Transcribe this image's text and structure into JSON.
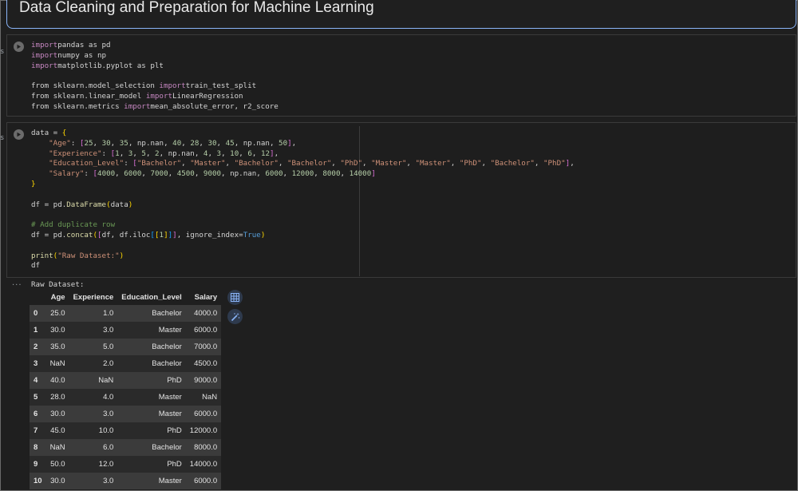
{
  "title": "Data Cleaning and Preparation for Machine Learning",
  "cell1": {
    "marker": "s",
    "lines": [
      [
        [
          "kw",
          "import"
        ],
        [
          "",
          "pandas as pd"
        ]
      ],
      [
        [
          "kw",
          "import"
        ],
        [
          "",
          "numpy as np"
        ]
      ],
      [
        [
          "kw",
          "import"
        ],
        [
          "",
          "matplotlib.pyplot as plt"
        ]
      ],
      [],
      [
        [
          "",
          "from sklearn.model_selection "
        ],
        [
          "kw",
          "import"
        ],
        [
          "",
          "train_test_split"
        ]
      ],
      [
        [
          "",
          "from sklearn.linear_model "
        ],
        [
          "kw",
          "import"
        ],
        [
          "",
          "LinearRegression"
        ]
      ],
      [
        [
          "",
          "from sklearn.metrics "
        ],
        [
          "kw",
          "import"
        ],
        [
          "",
          "mean_absolute_error, r2_score"
        ]
      ]
    ]
  },
  "cell2": {
    "marker": "s",
    "lines": [
      [
        [
          "",
          "data = "
        ],
        [
          "p1",
          "{"
        ]
      ],
      [
        [
          "",
          "    "
        ],
        [
          "str",
          "\"Age\""
        ],
        [
          "",
          ": "
        ],
        [
          "p2",
          "["
        ],
        [
          "num",
          "25"
        ],
        [
          "",
          ", "
        ],
        [
          "num",
          "30"
        ],
        [
          "",
          ", "
        ],
        [
          "num",
          "35"
        ],
        [
          "",
          ", np.nan, "
        ],
        [
          "num",
          "40"
        ],
        [
          "",
          ", "
        ],
        [
          "num",
          "28"
        ],
        [
          "",
          ", "
        ],
        [
          "num",
          "30"
        ],
        [
          "",
          ", "
        ],
        [
          "num",
          "45"
        ],
        [
          "",
          ", np.nan, "
        ],
        [
          "num",
          "50"
        ],
        [
          "p2",
          "]"
        ],
        [
          "",
          ","
        ]
      ],
      [
        [
          "",
          "    "
        ],
        [
          "str",
          "\"Experience\""
        ],
        [
          "",
          ": "
        ],
        [
          "p2",
          "["
        ],
        [
          "num",
          "1"
        ],
        [
          "",
          ", "
        ],
        [
          "num",
          "3"
        ],
        [
          "",
          ", "
        ],
        [
          "num",
          "5"
        ],
        [
          "",
          ", "
        ],
        [
          "num",
          "2"
        ],
        [
          "",
          ", np.nan, "
        ],
        [
          "num",
          "4"
        ],
        [
          "",
          ", "
        ],
        [
          "num",
          "3"
        ],
        [
          "",
          ", "
        ],
        [
          "num",
          "10"
        ],
        [
          "",
          ", "
        ],
        [
          "num",
          "6"
        ],
        [
          "",
          ", "
        ],
        [
          "num",
          "12"
        ],
        [
          "p2",
          "]"
        ],
        [
          "",
          ","
        ]
      ],
      [
        [
          "",
          "    "
        ],
        [
          "str",
          "\"Education_Level\""
        ],
        [
          "",
          ": "
        ],
        [
          "p2",
          "["
        ],
        [
          "str",
          "\"Bachelor\""
        ],
        [
          "",
          ", "
        ],
        [
          "str",
          "\"Master\""
        ],
        [
          "",
          ", "
        ],
        [
          "str",
          "\"Bachelor\""
        ],
        [
          "",
          ", "
        ],
        [
          "str",
          "\"Bachelor\""
        ],
        [
          "",
          ", "
        ],
        [
          "str",
          "\"PhD\""
        ],
        [
          "",
          ", "
        ],
        [
          "str",
          "\"Master\""
        ],
        [
          "",
          ", "
        ],
        [
          "str",
          "\"Master\""
        ],
        [
          "",
          ", "
        ],
        [
          "str",
          "\"PhD\""
        ],
        [
          "",
          ", "
        ],
        [
          "str",
          "\"Bachelor\""
        ],
        [
          "",
          ", "
        ],
        [
          "str",
          "\"PhD\""
        ],
        [
          "p2",
          "]"
        ],
        [
          "",
          ","
        ]
      ],
      [
        [
          "",
          "    "
        ],
        [
          "str",
          "\"Salary\""
        ],
        [
          "",
          ": "
        ],
        [
          "p2",
          "["
        ],
        [
          "num",
          "4000"
        ],
        [
          "",
          ", "
        ],
        [
          "num",
          "6000"
        ],
        [
          "",
          ", "
        ],
        [
          "num",
          "7000"
        ],
        [
          "",
          ", "
        ],
        [
          "num",
          "4500"
        ],
        [
          "",
          ", "
        ],
        [
          "num",
          "9000"
        ],
        [
          "",
          ", np.nan, "
        ],
        [
          "num",
          "6000"
        ],
        [
          "",
          ", "
        ],
        [
          "num",
          "12000"
        ],
        [
          "",
          ", "
        ],
        [
          "num",
          "8000"
        ],
        [
          "",
          ", "
        ],
        [
          "num",
          "14000"
        ],
        [
          "p2",
          "]"
        ]
      ],
      [
        [
          "p1",
          "}"
        ]
      ],
      [],
      [
        [
          "",
          "df = pd."
        ],
        [
          "fn",
          "DataFrame"
        ],
        [
          "p1",
          "("
        ],
        [
          "",
          "data"
        ],
        [
          "p1",
          ")"
        ]
      ],
      [],
      [
        [
          "cm",
          "# Add duplicate row"
        ]
      ],
      [
        [
          "",
          "df = pd."
        ],
        [
          "fn",
          "concat"
        ],
        [
          "p1",
          "("
        ],
        [
          "p2",
          "["
        ],
        [
          "",
          "df, df.iloc"
        ],
        [
          "p3",
          "["
        ],
        [
          "p1",
          "["
        ],
        [
          "num",
          "1"
        ],
        [
          "p1",
          "]"
        ],
        [
          "p3",
          "]"
        ],
        [
          "p2",
          "]"
        ],
        [
          "",
          ", ignore_index="
        ],
        [
          "bool",
          "True"
        ],
        [
          "p1",
          ")"
        ]
      ],
      [],
      [
        [
          "fn",
          "print"
        ],
        [
          "p1",
          "("
        ],
        [
          "str",
          "\"Raw Dataset:\""
        ],
        [
          "p1",
          ")"
        ]
      ],
      [
        [
          "",
          "df"
        ]
      ]
    ]
  },
  "output": {
    "ellipsis": "...",
    "label": "Raw Dataset:",
    "columns": [
      "",
      "Age",
      "Experience",
      "Education_Level",
      "Salary"
    ],
    "rows": [
      [
        "0",
        "25.0",
        "1.0",
        "Bachelor",
        "4000.0"
      ],
      [
        "1",
        "30.0",
        "3.0",
        "Master",
        "6000.0"
      ],
      [
        "2",
        "35.0",
        "5.0",
        "Bachelor",
        "7000.0"
      ],
      [
        "3",
        "NaN",
        "2.0",
        "Bachelor",
        "4500.0"
      ],
      [
        "4",
        "40.0",
        "NaN",
        "PhD",
        "9000.0"
      ],
      [
        "5",
        "28.0",
        "4.0",
        "Master",
        "NaN"
      ],
      [
        "6",
        "30.0",
        "3.0",
        "Master",
        "6000.0"
      ],
      [
        "7",
        "45.0",
        "10.0",
        "PhD",
        "12000.0"
      ],
      [
        "8",
        "NaN",
        "6.0",
        "Bachelor",
        "8000.0"
      ],
      [
        "9",
        "50.0",
        "12.0",
        "PhD",
        "14000.0"
      ],
      [
        "10",
        "30.0",
        "3.0",
        "Master",
        "6000.0"
      ]
    ]
  },
  "icons": {
    "run": "play-icon",
    "table": "table-icon",
    "magic": "magic-wand-icon"
  }
}
